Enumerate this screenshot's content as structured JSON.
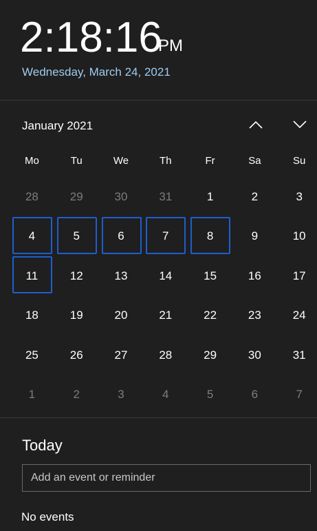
{
  "clock": {
    "time": "2:18:16",
    "ampm": "PM",
    "date": "Wednesday, March 24, 2021"
  },
  "calendar": {
    "month_label": "January 2021",
    "weekdays": [
      "Mo",
      "Tu",
      "We",
      "Th",
      "Fr",
      "Sa",
      "Su"
    ],
    "weeks": [
      [
        {
          "day": "28",
          "other": true
        },
        {
          "day": "29",
          "other": true
        },
        {
          "day": "30",
          "other": true
        },
        {
          "day": "31",
          "other": true
        },
        {
          "day": "1"
        },
        {
          "day": "2"
        },
        {
          "day": "3"
        }
      ],
      [
        {
          "day": "4",
          "highlight": true
        },
        {
          "day": "5",
          "highlight": true
        },
        {
          "day": "6",
          "highlight": true
        },
        {
          "day": "7",
          "highlight": true
        },
        {
          "day": "8",
          "highlight": true
        },
        {
          "day": "9"
        },
        {
          "day": "10"
        }
      ],
      [
        {
          "day": "11",
          "highlight": true
        },
        {
          "day": "12"
        },
        {
          "day": "13"
        },
        {
          "day": "14"
        },
        {
          "day": "15"
        },
        {
          "day": "16"
        },
        {
          "day": "17"
        }
      ],
      [
        {
          "day": "18"
        },
        {
          "day": "19"
        },
        {
          "day": "20"
        },
        {
          "day": "21"
        },
        {
          "day": "22"
        },
        {
          "day": "23"
        },
        {
          "day": "24"
        }
      ],
      [
        {
          "day": "25"
        },
        {
          "day": "26"
        },
        {
          "day": "27"
        },
        {
          "day": "28"
        },
        {
          "day": "29"
        },
        {
          "day": "30"
        },
        {
          "day": "31"
        }
      ],
      [
        {
          "day": "1",
          "other": true
        },
        {
          "day": "2",
          "other": true
        },
        {
          "day": "3",
          "other": true
        },
        {
          "day": "4",
          "other": true
        },
        {
          "day": "5",
          "other": true
        },
        {
          "day": "6",
          "other": true
        },
        {
          "day": "7",
          "other": true
        }
      ]
    ],
    "icons": {
      "prev": "chevron-up-icon",
      "next": "chevron-down-icon"
    }
  },
  "agenda": {
    "today_label": "Today",
    "event_input_placeholder": "Add an event or reminder",
    "no_events": "No events"
  },
  "colors": {
    "background": "#1f1f1f",
    "date_accent": "#9fcbef",
    "highlight_border": "#1e5ecf",
    "other_month_text": "#7d7d7d"
  }
}
